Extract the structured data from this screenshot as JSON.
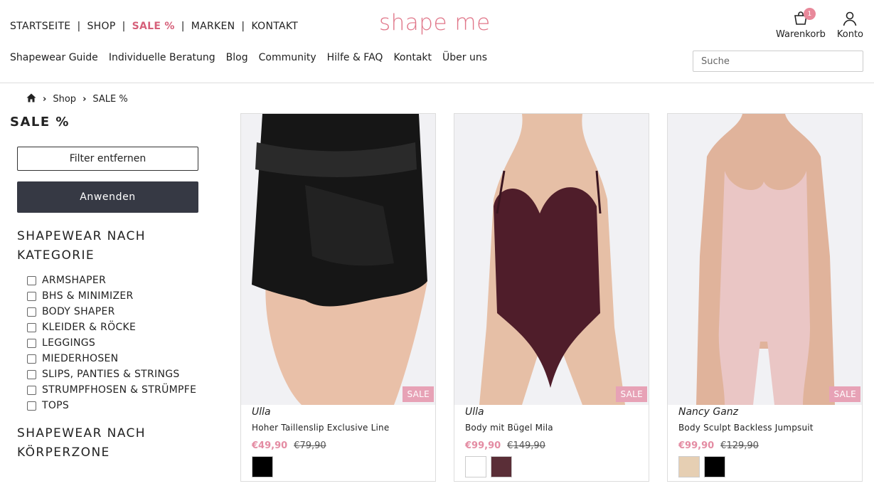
{
  "header": {
    "top_nav": [
      "STARTSEITE",
      "SHOP",
      "SALE %",
      "MARKEN",
      "KONTAKT"
    ],
    "logo": "shape me",
    "sub_nav": [
      "Shapewear Guide",
      "Individuelle Beratung",
      "Blog",
      "Community",
      "Hilfe & FAQ",
      "Kontakt",
      "Über uns"
    ],
    "cart_label": "Warenkorb",
    "cart_count": "1",
    "account_label": "Konto",
    "search_placeholder": "Suche"
  },
  "breadcrumb": [
    "Shop",
    "SALE %"
  ],
  "sidebar": {
    "title": "SALE %",
    "remove_filter": "Filter entfernen",
    "apply": "Anwenden",
    "category_heading_line1": "SHAPEWEAR NACH",
    "category_heading_line2": "KATEGORIE",
    "categories": [
      "ARMSHAPER",
      "BHS & MINIMIZER",
      "BODY SHAPER",
      "KLEIDER & RÖCKE",
      "LEGGINGS",
      "MIEDERHOSEN",
      "SLIPS, PANTIES & STRINGS",
      "STRUMPFHOSEN & STRÜMPFE",
      "TOPS"
    ],
    "zone_heading_line1": "SHAPEWEAR NACH",
    "zone_heading_line2": "KÖRPERZONE"
  },
  "products": [
    {
      "badge": "SALE",
      "brand": "Ulla",
      "name": "Hoher Taillenslip Exclusive Line",
      "price": "€49,90",
      "old_price": "€79,90",
      "swatches": [
        "#000000"
      ]
    },
    {
      "badge": "SALE",
      "brand": "Ulla",
      "name": "Body mit Bügel Mila",
      "price": "€99,90",
      "old_price": "€149,90",
      "swatches": [
        "#ffffff",
        "#5a2e37"
      ]
    },
    {
      "badge": "SALE",
      "brand": "Nancy Ganz",
      "name": "Body Sculpt Backless Jumpsuit",
      "price": "€99,90",
      "old_price": "€129,90",
      "swatches": [
        "#e6cfb3",
        "#000000"
      ]
    }
  ],
  "colors": {
    "accent": "#e07689",
    "sale_badge": "#e7a2b6",
    "dark_button": "#363944"
  }
}
